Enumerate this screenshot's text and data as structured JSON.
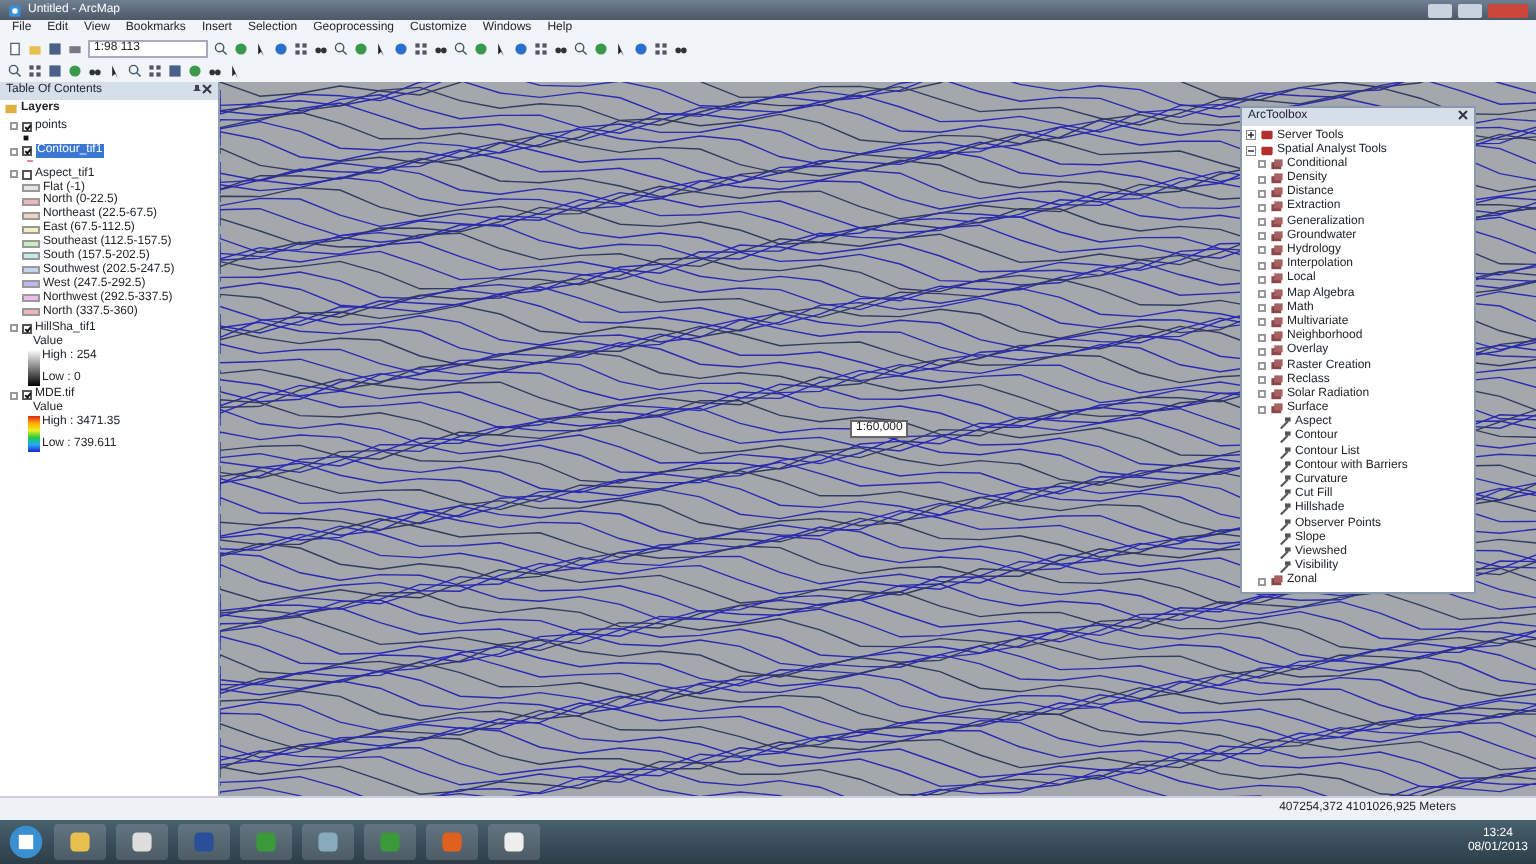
{
  "window": {
    "title": "Untitled - ArcMap"
  },
  "menu": [
    "File",
    "Edit",
    "View",
    "Bookmarks",
    "Insert",
    "Selection",
    "Geoprocessing",
    "Customize",
    "Windows",
    "Help"
  ],
  "toolbar": {
    "scale": "1:98 113"
  },
  "toc": {
    "title": "Table Of Contents",
    "root": "Layers",
    "layers": [
      {
        "name": "points",
        "kind": "point",
        "checked": true,
        "selected": false
      },
      {
        "name": "Contour_tif1",
        "kind": "line",
        "checked": true,
        "selected": true
      },
      {
        "name": "Aspect_tif1",
        "kind": "classes",
        "checked": false,
        "selected": false,
        "legend": [
          {
            "label": "Flat (-1)",
            "color": "#e4e4e4"
          },
          {
            "label": "North (0-22.5)",
            "color": "#eab8b8"
          },
          {
            "label": "Northeast (22.5-67.5)",
            "color": "#eed8c0"
          },
          {
            "label": "East (67.5-112.5)",
            "color": "#f6eec0"
          },
          {
            "label": "Southeast (112.5-157.5)",
            "color": "#c8eebc"
          },
          {
            "label": "South (157.5-202.5)",
            "color": "#c4ecec"
          },
          {
            "label": "Southwest (202.5-247.5)",
            "color": "#c4d4ee"
          },
          {
            "label": "West (247.5-292.5)",
            "color": "#c0b8ec"
          },
          {
            "label": "Northwest (292.5-337.5)",
            "color": "#ecbcec"
          },
          {
            "label": "North (337.5-360)",
            "color": "#eab8b8"
          }
        ]
      },
      {
        "name": "HillSha_tif1",
        "checked": true,
        "selected": false,
        "kind": "gray_ramp",
        "value": "Value",
        "high": "High : 254",
        "low": "Low : 0"
      },
      {
        "name": "MDE.tif",
        "checked": true,
        "selected": false,
        "kind": "color_ramp",
        "value": "Value",
        "high": "High : 3471.35",
        "low": "Low : 739.611"
      }
    ]
  },
  "map": {
    "label": "1:60,000"
  },
  "toolbox": {
    "title": "ArcToolbox",
    "items": [
      {
        "label": "Server Tools",
        "expanded": false
      },
      {
        "label": "Spatial Analyst Tools",
        "expanded": true,
        "children": [
          {
            "label": "Conditional",
            "kind": "toolset"
          },
          {
            "label": "Density",
            "kind": "toolset"
          },
          {
            "label": "Distance",
            "kind": "toolset"
          },
          {
            "label": "Extraction",
            "kind": "toolset"
          },
          {
            "label": "Generalization",
            "kind": "toolset"
          },
          {
            "label": "Groundwater",
            "kind": "toolset"
          },
          {
            "label": "Hydrology",
            "kind": "toolset"
          },
          {
            "label": "Interpolation",
            "kind": "toolset"
          },
          {
            "label": "Local",
            "kind": "toolset"
          },
          {
            "label": "Map Algebra",
            "kind": "toolset"
          },
          {
            "label": "Math",
            "kind": "toolset"
          },
          {
            "label": "Multivariate",
            "kind": "toolset"
          },
          {
            "label": "Neighborhood",
            "kind": "toolset"
          },
          {
            "label": "Overlay",
            "kind": "toolset"
          },
          {
            "label": "Raster Creation",
            "kind": "toolset"
          },
          {
            "label": "Reclass",
            "kind": "toolset"
          },
          {
            "label": "Solar Radiation",
            "kind": "toolset"
          },
          {
            "label": "Surface",
            "kind": "toolset-open"
          },
          {
            "label": "Aspect",
            "kind": "tool"
          },
          {
            "label": "Contour",
            "kind": "tool"
          },
          {
            "label": "Contour List",
            "kind": "tool"
          },
          {
            "label": "Contour with Barriers",
            "kind": "tool"
          },
          {
            "label": "Curvature",
            "kind": "tool"
          },
          {
            "label": "Cut Fill",
            "kind": "tool"
          },
          {
            "label": "Hillshade",
            "kind": "tool"
          },
          {
            "label": "Observer Points",
            "kind": "tool"
          },
          {
            "label": "Slope",
            "kind": "tool"
          },
          {
            "label": "Viewshed",
            "kind": "tool"
          },
          {
            "label": "Visibility",
            "kind": "tool"
          },
          {
            "label": "Zonal",
            "kind": "toolset"
          }
        ]
      }
    ]
  },
  "status_bar": {
    "coordinates": "407254,372  4101026,925 Meters"
  },
  "taskbar": {
    "time": "13:24",
    "date": "08/01/2013"
  }
}
